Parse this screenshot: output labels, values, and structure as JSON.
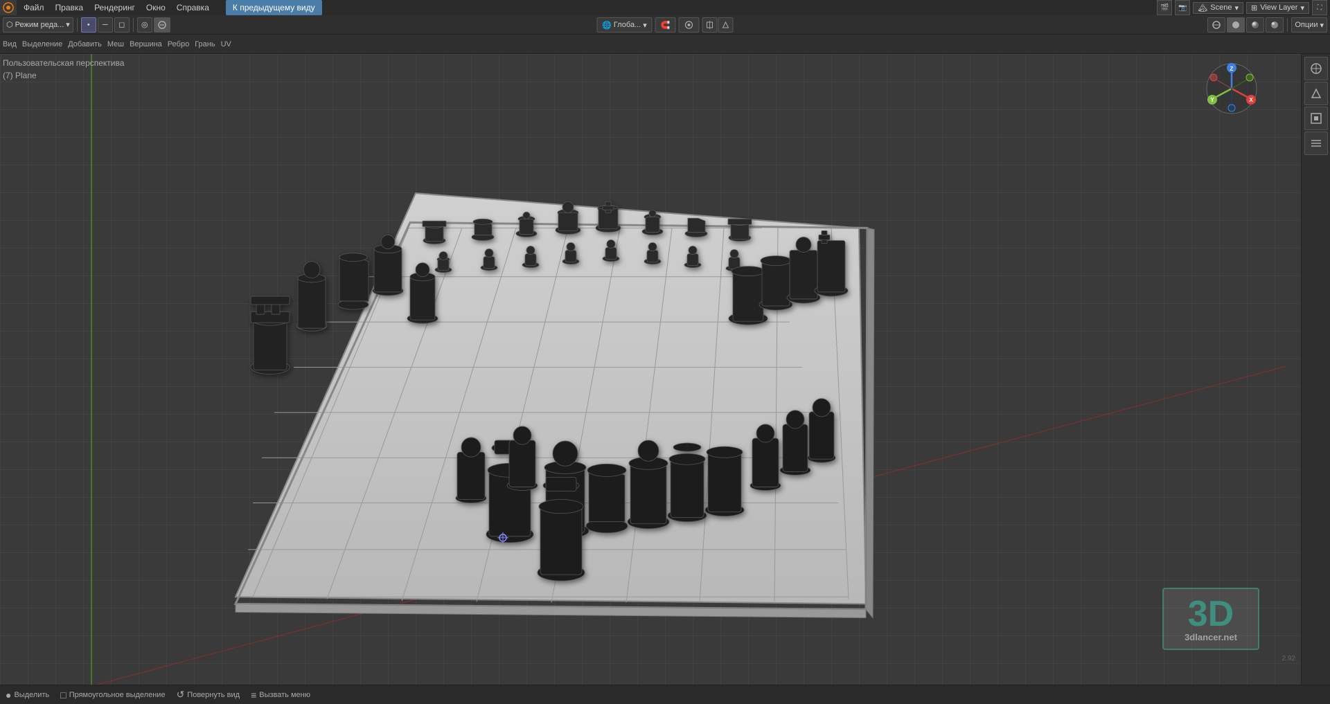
{
  "app": {
    "title": "Blender",
    "version": "2.92"
  },
  "top_menu": {
    "logo": "🔷",
    "items": [
      "Файл",
      "Правка",
      "Рендеринг",
      "Окно",
      "Справка"
    ],
    "back_button": "К предыдущему виду",
    "scene_label": "Scene",
    "view_layer_label": "View Layer"
  },
  "toolbar": {
    "mode_label": "Режим реда...",
    "edit_items": [
      "Вид",
      "Выделение",
      "Добавить",
      "Меш",
      "Вершина",
      "Ребро",
      "Грань",
      "UV"
    ]
  },
  "viewport": {
    "perspective_label": "Пользовательская перспектива",
    "object_label": "(7) Plane",
    "global_label": "Глоба..."
  },
  "status_bar": {
    "select_label": "Выделить",
    "select_icon": "●",
    "box_select_label": "Прямоугольное выделение",
    "box_icon": "□",
    "rotate_label": "Повернуть вид",
    "rotate_icon": "↺",
    "menu_label": "Вызвать меню",
    "menu_icon": "≡"
  },
  "watermark": {
    "text_3d": "3D",
    "site": "3dlancer.net"
  },
  "nav_gizmo": {
    "x_label": "X",
    "y_label": "Y",
    "z_label": "Z",
    "x_color": "#e04040",
    "y_color": "#80c040",
    "z_color": "#4080e0",
    "x_neg_color": "#804040",
    "y_neg_color": "#406020",
    "z_neg_color": "#204060"
  }
}
